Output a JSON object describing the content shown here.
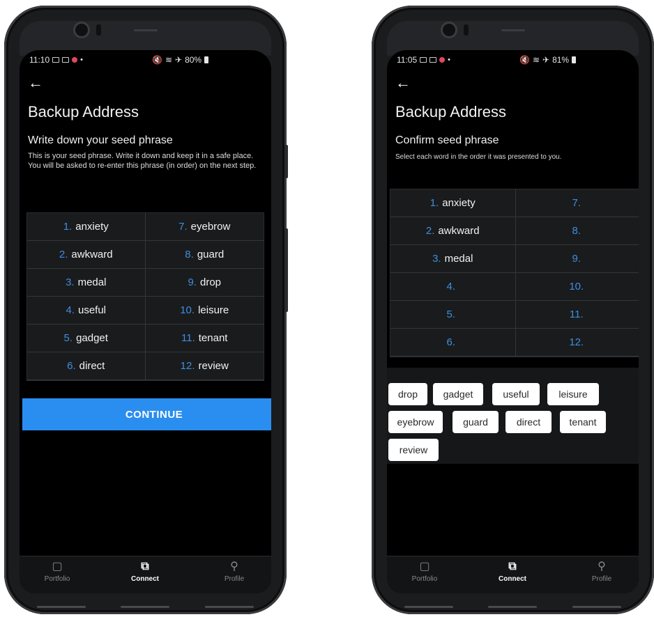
{
  "left_phone": {
    "status": {
      "time": "11:10",
      "battery": "80%"
    },
    "title": "Backup Address",
    "subtitle": "Write down your seed phrase",
    "description": "This is your seed phrase. Write it down and keep it in a safe place. You will be asked to re-enter this phrase (in order) on the next step.",
    "words": [
      {
        "num": "1.",
        "word": "anxiety"
      },
      {
        "num": "7.",
        "word": "eyebrow"
      },
      {
        "num": "2.",
        "word": "awkward"
      },
      {
        "num": "8.",
        "word": "guard"
      },
      {
        "num": "3.",
        "word": "medal"
      },
      {
        "num": "9.",
        "word": "drop"
      },
      {
        "num": "4.",
        "word": "useful"
      },
      {
        "num": "10.",
        "word": "leisure"
      },
      {
        "num": "5.",
        "word": "gadget"
      },
      {
        "num": "11.",
        "word": "tenant"
      },
      {
        "num": "6.",
        "word": "direct"
      },
      {
        "num": "12.",
        "word": "review"
      }
    ],
    "continue_label": "CONTINUE"
  },
  "right_phone": {
    "status": {
      "time": "11:05",
      "battery": "81%"
    },
    "title": "Backup Address",
    "subtitle": "Confirm seed phrase",
    "description": "Select each word in the order it was presented to you.",
    "words": [
      {
        "num": "1.",
        "word": "anxiety"
      },
      {
        "num": "7.",
        "word": ""
      },
      {
        "num": "2.",
        "word": "awkward"
      },
      {
        "num": "8.",
        "word": ""
      },
      {
        "num": "3.",
        "word": "medal"
      },
      {
        "num": "9.",
        "word": ""
      },
      {
        "num": "4.",
        "word": ""
      },
      {
        "num": "10.",
        "word": ""
      },
      {
        "num": "5.",
        "word": ""
      },
      {
        "num": "11.",
        "word": ""
      },
      {
        "num": "6.",
        "word": ""
      },
      {
        "num": "12.",
        "word": ""
      }
    ],
    "chips": [
      "drop",
      "gadget",
      "useful",
      "leisure",
      "eyebrow",
      "guard",
      "direct",
      "tenant",
      "review"
    ]
  },
  "nav": {
    "portfolio": "Portfolio",
    "connect": "Connect",
    "profile": "Profile"
  },
  "colors": {
    "accent": "#2a8ef0",
    "number": "#3d8fe0",
    "background": "#000000"
  },
  "icons": {
    "back": "arrow-left-icon",
    "portfolio": "wallet-icon",
    "connect": "connect-icon",
    "profile": "person-icon"
  }
}
